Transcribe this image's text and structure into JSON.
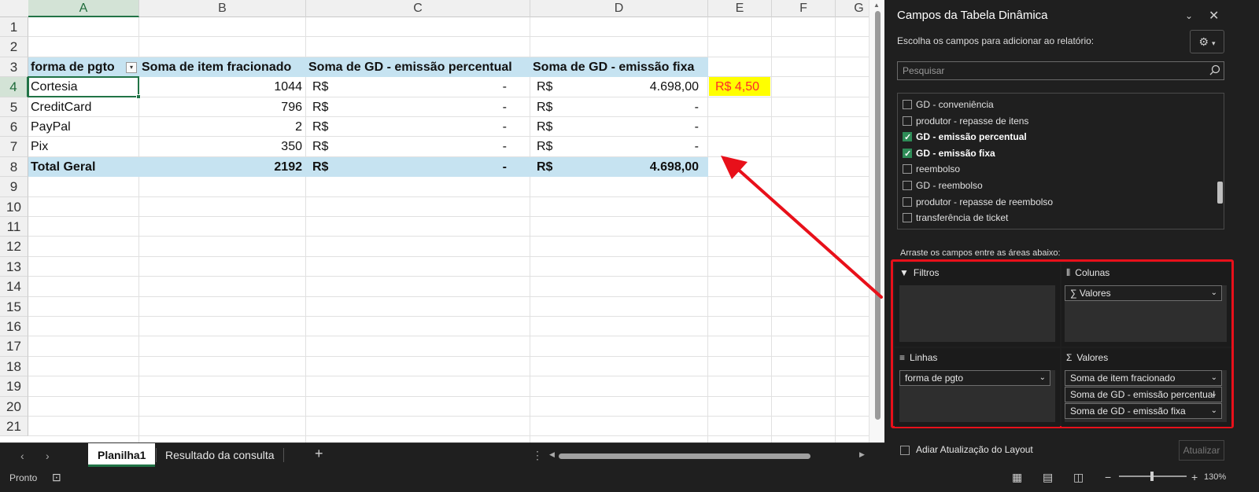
{
  "sheet": {
    "columns": [
      "A",
      "B",
      "C",
      "D",
      "E",
      "F",
      "G"
    ],
    "rows": [
      "1",
      "2",
      "3",
      "4",
      "5",
      "6",
      "7",
      "8",
      "9",
      "10",
      "11",
      "12",
      "13",
      "14",
      "15",
      "16",
      "17",
      "18",
      "19",
      "20",
      "21"
    ],
    "active_cell": "A4",
    "pivot": {
      "headers": [
        "forma de pgto",
        "Soma de item fracionado",
        "Soma de GD - emissão percentual",
        "Soma de GD - emissão fixa"
      ],
      "rows": [
        {
          "label": "Cortesia",
          "item": "1044",
          "pct_cur": "R$",
          "pct_val": "-",
          "fixa_cur": "R$",
          "fixa_val": "4.698,00"
        },
        {
          "label": "CreditCard",
          "item": "796",
          "pct_cur": "R$",
          "pct_val": "-",
          "fixa_cur": "R$",
          "fixa_val": "-"
        },
        {
          "label": "PayPal",
          "item": "2",
          "pct_cur": "R$",
          "pct_val": "-",
          "fixa_cur": "R$",
          "fixa_val": "-"
        },
        {
          "label": "Pix",
          "item": "350",
          "pct_cur": "R$",
          "pct_val": "-",
          "fixa_cur": "R$",
          "fixa_val": "-"
        }
      ],
      "total": {
        "label": "Total Geral",
        "item": "2192",
        "pct_cur": "R$",
        "pct_val": "-",
        "fixa_cur": "R$",
        "fixa_val": "4.698,00"
      }
    },
    "e4_value": "R$  4,50",
    "highlight_color": "#ffff00",
    "header_band_color": "#c6e3f1"
  },
  "tabs": {
    "items": [
      "Planilha1",
      "Resultado da consulta"
    ],
    "active": "Planilha1",
    "add_label": "+"
  },
  "status": {
    "text": "Pronto",
    "zoom": "130%",
    "zoom_minus": "−",
    "zoom_plus": "+"
  },
  "pane": {
    "title": "Campos da Tabela Dinâmica",
    "subtitle": "Escolha os campos para adicionar ao relatório:",
    "search_placeholder": "Pesquisar",
    "fields": [
      {
        "label": "GD - conveniência",
        "checked": false
      },
      {
        "label": "produtor - repasse de itens",
        "checked": false
      },
      {
        "label": "GD - emissão percentual",
        "checked": true
      },
      {
        "label": "GD - emissão fixa",
        "checked": true
      },
      {
        "label": "reembolso",
        "checked": false
      },
      {
        "label": "GD - reembolso",
        "checked": false
      },
      {
        "label": "produtor - repasse de reembolso",
        "checked": false
      },
      {
        "label": "transferência de ticket",
        "checked": false
      }
    ],
    "drag_label": "Arraste os campos entre as áreas abaixo:",
    "areas": {
      "filtros": {
        "title": "Filtros",
        "items": []
      },
      "colunas": {
        "title": "Colunas",
        "items": [
          "∑  Valores"
        ]
      },
      "linhas": {
        "title": "Linhas",
        "items": [
          "forma de pgto"
        ]
      },
      "valores": {
        "title": "Valores",
        "items": [
          "Soma de item fracionado",
          "Soma de GD - emissão percentual",
          "Soma de GD - emissão fixa"
        ]
      }
    },
    "defer_label": "Adiar Atualização do Layout",
    "update_label": "Atualizar",
    "annotation_color": "#e8101a"
  }
}
